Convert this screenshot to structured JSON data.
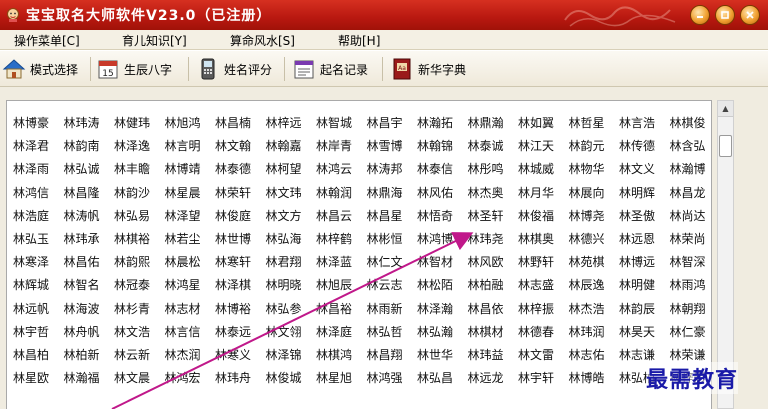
{
  "window": {
    "title": "宝宝取名大师软件V23.0（已注册）"
  },
  "menu": [
    {
      "label": "操作菜单[C]"
    },
    {
      "label": "育儿知识[Y]"
    },
    {
      "label": "算命风水[S]"
    },
    {
      "label": "帮助[H]"
    }
  ],
  "toolbar": [
    {
      "label": "模式选择",
      "icon": "house-icon"
    },
    {
      "label": "生辰八字",
      "icon": "calendar-icon"
    },
    {
      "label": "姓名评分",
      "icon": "phone-icon"
    },
    {
      "label": "起名记录",
      "icon": "record-icon"
    },
    {
      "label": "新华字典",
      "icon": "dictionary-icon"
    }
  ],
  "names": [
    "林博豪",
    "林玮涛",
    "林健玮",
    "林旭鸿",
    "林昌楠",
    "林梓远",
    "林智城",
    "林昌宇",
    "林瀚拓",
    "林鼎瀚",
    "林如翼",
    "林哲星",
    "林言浩",
    "林棋俊",
    "林泽君",
    "林韵南",
    "林泽逸",
    "林言明",
    "林文翰",
    "林翰嘉",
    "林岸青",
    "林雪博",
    "林翰锦",
    "林泰诚",
    "林江天",
    "林韵元",
    "林传德",
    "林含弘",
    "林泽雨",
    "林弘诚",
    "林丰瞻",
    "林博靖",
    "林泰德",
    "林柯望",
    "林鸿云",
    "林涛邦",
    "林泰信",
    "林彤鸣",
    "林城威",
    "林物华",
    "林文义",
    "林瀚博",
    "林鸿信",
    "林昌隆",
    "林韵沙",
    "林星晨",
    "林荣轩",
    "林文玮",
    "林翰润",
    "林鼎海",
    "林风佑",
    "林杰奥",
    "林月华",
    "林展向",
    "林明辉",
    "林昌龙",
    "林浩庭",
    "林涛帆",
    "林弘易",
    "林泽望",
    "林俊庭",
    "林文方",
    "林昌云",
    "林昌星",
    "林悟奇",
    "林圣轩",
    "林俊福",
    "林博尧",
    "林圣傲",
    "林尚达",
    "林弘玉",
    "林玮承",
    "林棋裕",
    "林若尘",
    "林世博",
    "林弘海",
    "林梓鹤",
    "林彬恒",
    "林鸿博",
    "林玮尧",
    "林棋奥",
    "林德兴",
    "林远恩",
    "林荣尚",
    "林寒泽",
    "林昌佑",
    "林韵熙",
    "林晨松",
    "林寒轩",
    "林君翔",
    "林泽蓝",
    "林仁文",
    "林智材",
    "林风欧",
    "林野轩",
    "林苑棋",
    "林博远",
    "林智深",
    "林辉城",
    "林智名",
    "林冠泰",
    "林鸿星",
    "林泽棋",
    "林明晓",
    "林旭辰",
    "林云志",
    "林松陌",
    "林柏融",
    "林志盛",
    "林辰逸",
    "林明健",
    "林雨鸿",
    "林远帆",
    "林海波",
    "林杉青",
    "林志材",
    "林博裕",
    "林弘参",
    "林昌裕",
    "林雨新",
    "林泽瀚",
    "林昌依",
    "林梓振",
    "林杰浩",
    "林韵辰",
    "林朝翔",
    "林宇哲",
    "林舟帆",
    "林文浩",
    "林言信",
    "林泰远",
    "林文翎",
    "林泽庭",
    "林弘哲",
    "林弘瀚",
    "林棋材",
    "林德春",
    "林玮润",
    "林昊天",
    "林仁豪",
    "林昌柏",
    "林柏新",
    "林云新",
    "林杰润",
    "林寒义",
    "林泽锦",
    "林棋鸿",
    "林昌翔",
    "林世华",
    "林玮益",
    "林文雷",
    "林志佑",
    "林志谦",
    "林荣谦",
    "林星欧",
    "林瀚福",
    "林文晨",
    "林鸿宏",
    "林玮舟",
    "林俊城",
    "林星旭",
    "林鸿强",
    "林弘昌",
    "林远龙",
    "林宇轩",
    "林博皓",
    "林弘柏",
    "林梓影"
  ],
  "watermark": "最需教育"
}
